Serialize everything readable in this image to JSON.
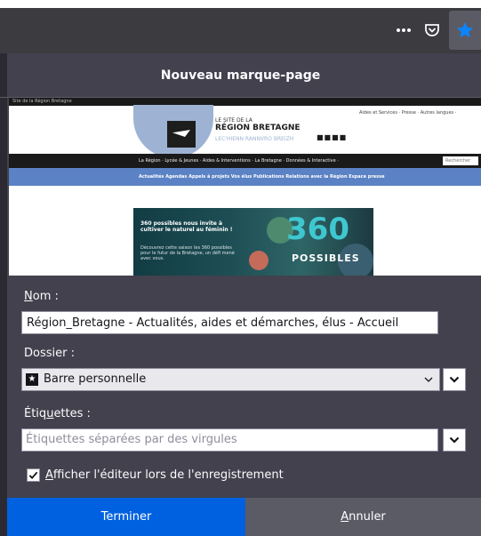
{
  "toolbar": {
    "more_icon": "more-horizontal-icon",
    "pocket_icon": "pocket-icon",
    "star_icon": "bookmark-star-icon",
    "star_color": "#0a84ff"
  },
  "panel": {
    "title": "Nouveau marque-page"
  },
  "preview": {
    "url_bar_text": "Site de la Région Bretagne",
    "site_line1": "LE SITE DE LA",
    "site_line2": "RÉGION BRETAGNE",
    "site_line3": "LEC'HIENN RANNVRO BREIZH",
    "top_links": "Aides et Services ·  Presse ·  Autres langues ·",
    "main_nav": "La Région ·     Lycée & Jeunes ·     Aides & Interventions ·     La Bretagne ·     Données & Interactive ·",
    "search_placeholder": "Rechercher",
    "blue_nav": "Actualités     Agendas     Appels à projets     Vos élus     Publications     Relations avec la Région     Espace presse",
    "banner_text1": "360 possibles nous invite à cultiver le naturel au féminin !",
    "banner_text2": "Découvrez cette saison les 360 possibles pour le futur de la Bretagne, un défi mené avec vous.",
    "banner_big": "360",
    "banner_sub": "POSSIBLES"
  },
  "form": {
    "name_label_u": "N",
    "name_label_rest": "om :",
    "name_value": "Région_Bretagne - Actualités, aides et démarches, élus - Accueil",
    "folder_label": "Dossier :",
    "folder_value": "Barre personnelle",
    "folder_icon": "bookmarks-toolbar-icon",
    "tags_label_pre": "Étiq",
    "tags_label_u": "u",
    "tags_label_post": "ettes :",
    "tags_placeholder": "Étiquettes séparées par des virgules",
    "show_editor_u": "A",
    "show_editor_rest": "fficher l'éditeur lors de l'enregistrement",
    "show_editor_checked": true
  },
  "footer": {
    "done_label": "Terminer",
    "cancel_u": "A",
    "cancel_rest": "nnuler"
  }
}
